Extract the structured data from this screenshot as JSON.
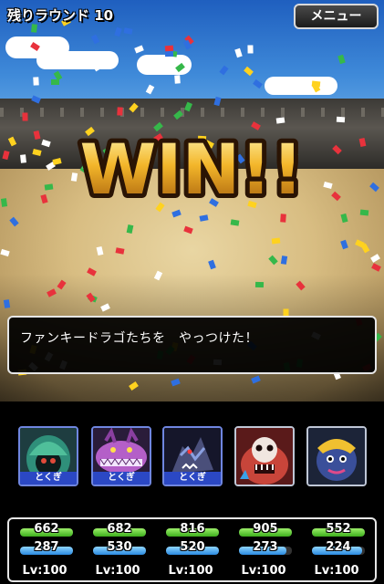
{
  "header": {
    "round_label": "残りラウンド 10",
    "menu_label": "メニュー"
  },
  "banner": {
    "text": "WIN!!"
  },
  "message": {
    "text": "ファンキードラゴたちを　やっつけた！"
  },
  "party": [
    {
      "skill_tag": "とくぎ",
      "hp": "662",
      "mp": "287",
      "level": "Lv:100",
      "hp_fill": 1.0,
      "mp_fill": 1.0
    },
    {
      "skill_tag": "とくぎ",
      "hp": "682",
      "mp": "530",
      "level": "Lv:100",
      "hp_fill": 1.0,
      "mp_fill": 1.0
    },
    {
      "skill_tag": "とくぎ",
      "hp": "816",
      "mp": "520",
      "level": "Lv:100",
      "hp_fill": 1.0,
      "mp_fill": 1.0
    },
    {
      "skill_tag": "",
      "hp": "905",
      "mp": "273",
      "level": "Lv:100",
      "hp_fill": 1.0,
      "mp_fill": 0.9
    },
    {
      "skill_tag": "",
      "hp": "552",
      "mp": "224",
      "level": "Lv:100",
      "hp_fill": 1.0,
      "mp_fill": 0.95
    }
  ],
  "colors": {
    "hp_bar": "#3cae1c",
    "mp_bar": "#2a8ae0",
    "skill_tag_bg": "#2b48c4",
    "banner_gold": "#f3b62a"
  }
}
